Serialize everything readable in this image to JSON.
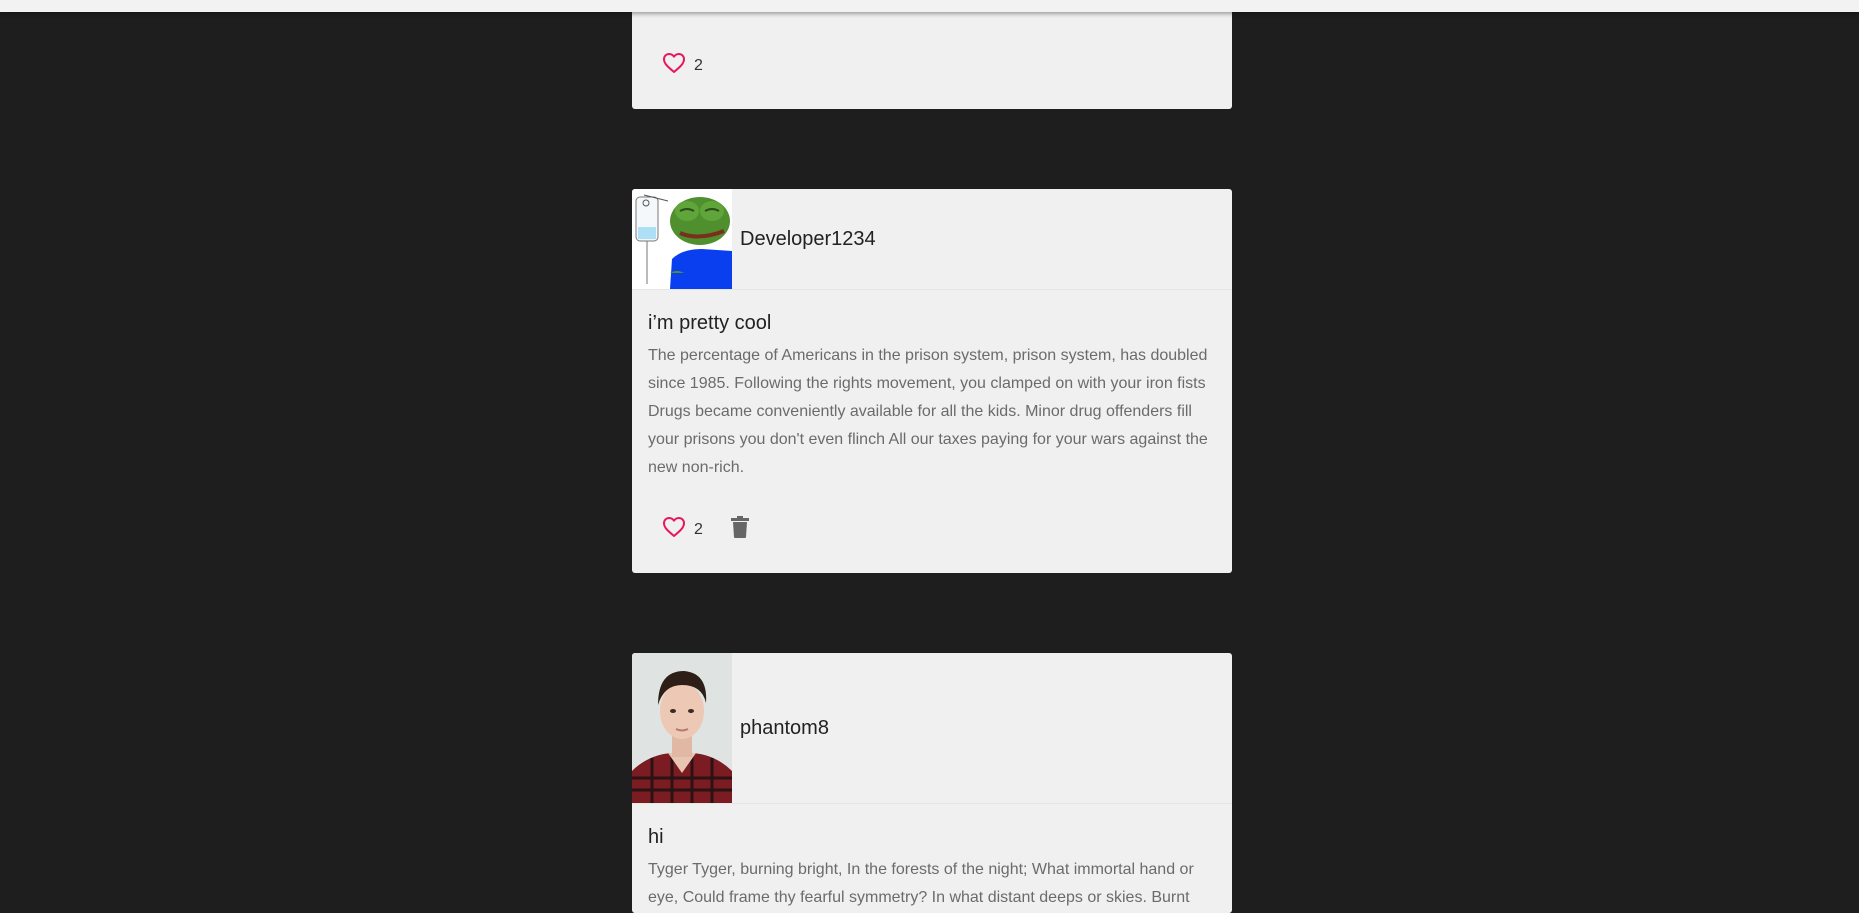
{
  "colors": {
    "page_background": "#1e1e1e",
    "card_background": "#f0f0f0",
    "like_accent": "#e8175d",
    "text_muted": "#6b6b6b"
  },
  "posts": [
    {
      "partial": true,
      "likes": "2",
      "like_icon": "heart-outline-icon"
    },
    {
      "author": "Developer1234",
      "avatar_icon": "pepe-frog-avatar",
      "title": "i’m pretty cool",
      "body": "The percentage of Americans in the prison system, prison system, has doubled since 1985. Following the rights movement, you clamped on with your iron fists Drugs became conveniently available for all the kids. Minor drug offenders fill your prisons you don't even flinch All our taxes paying for your wars against the new non-rich.",
      "likes": "2",
      "like_icon": "heart-outline-icon",
      "delete_icon": "trash-icon"
    },
    {
      "author": "phantom8",
      "avatar_icon": "portrait-photo-avatar",
      "title": "hi",
      "body": "Tyger Tyger, burning bright, In the forests of the night; What immortal hand or eye, Could frame thy fearful symmetry? In what distant deeps or skies. Burnt"
    }
  ]
}
